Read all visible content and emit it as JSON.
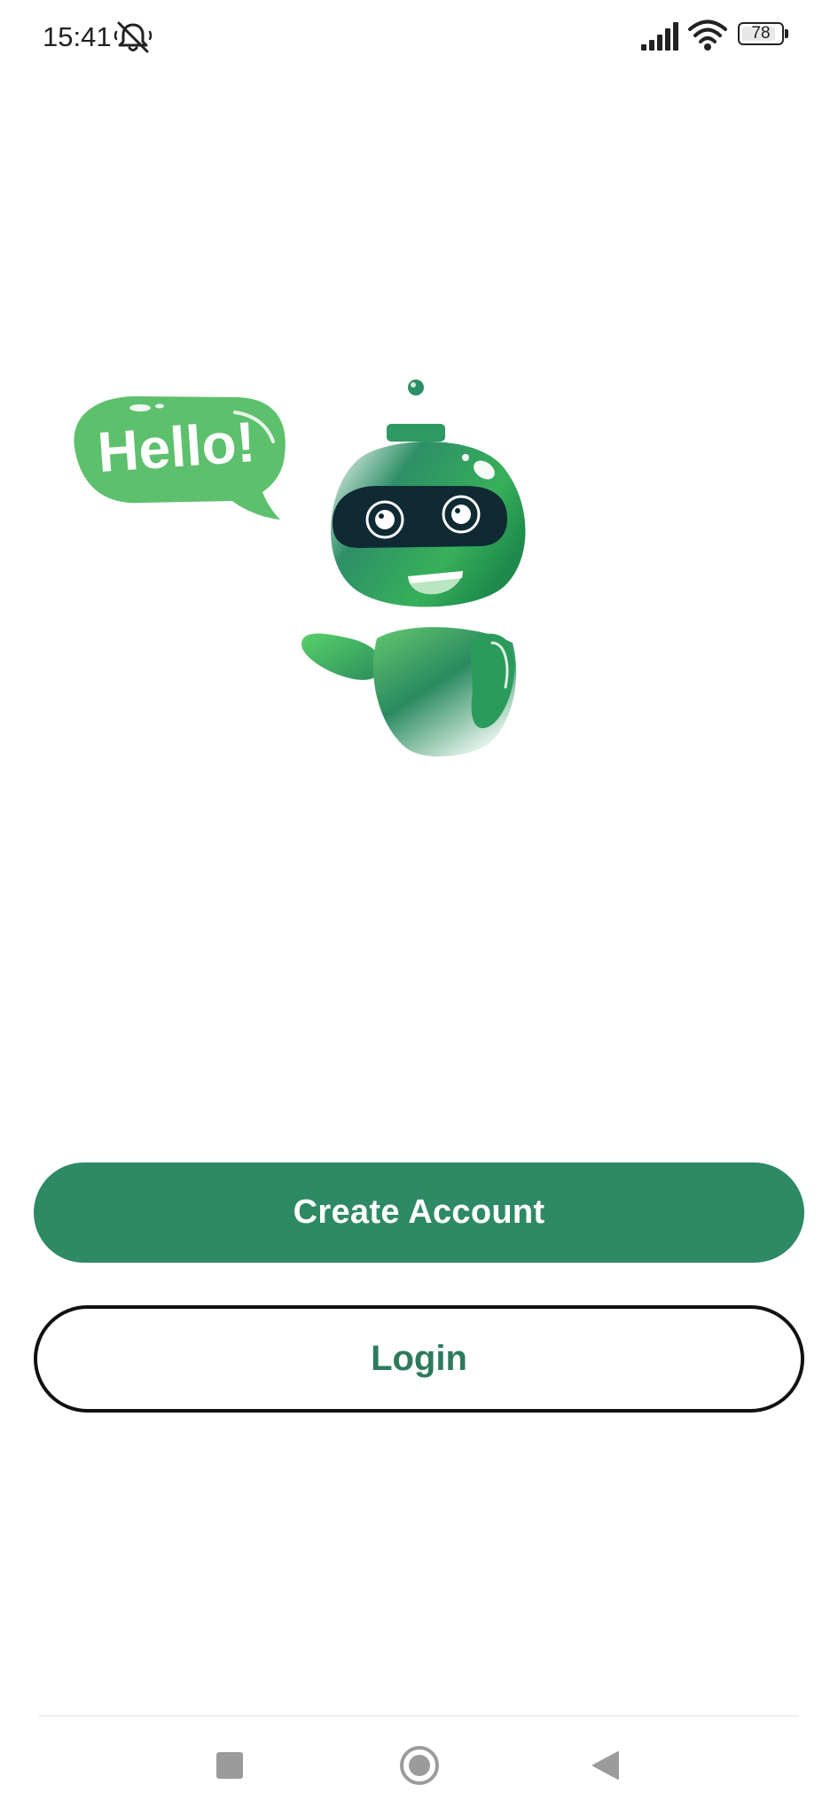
{
  "status_bar": {
    "time": "15:41",
    "battery_level": "78",
    "icons": [
      "bell-muted-icon",
      "signal-icon",
      "wifi-icon",
      "battery-icon"
    ]
  },
  "illustration": {
    "speech_bubble_text": "Hello!",
    "brand_colors": {
      "green_primary": "#2e8965",
      "green_light": "#5cc46d",
      "visor_dark": "#0f2a33"
    }
  },
  "actions": {
    "create_account_label": "Create Account",
    "login_label": "Login"
  },
  "navigation_bar": {
    "icons": [
      "recents-square-icon",
      "home-circle-icon",
      "back-triangle-icon"
    ]
  }
}
